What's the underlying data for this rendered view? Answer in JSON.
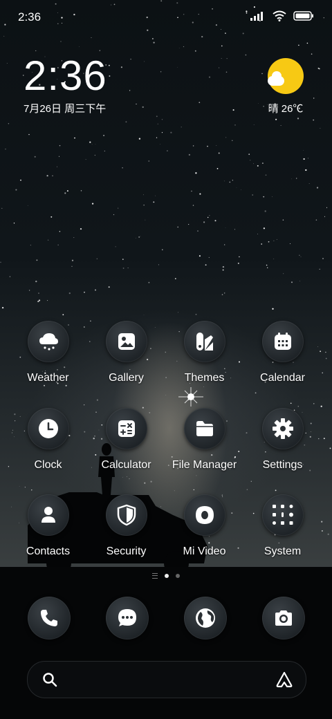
{
  "status_bar": {
    "time": "2:36",
    "icons": [
      "signal-icon",
      "wifi-icon",
      "battery-icon"
    ]
  },
  "clock_widget": {
    "time": "2:36",
    "date": "7月26日 周三下午"
  },
  "weather_widget": {
    "icon": "sun-cloud-icon",
    "text": "晴 26℃"
  },
  "apps": [
    {
      "label": "Weather",
      "icon": "weather-icon"
    },
    {
      "label": "Gallery",
      "icon": "gallery-icon"
    },
    {
      "label": "Themes",
      "icon": "themes-icon"
    },
    {
      "label": "Calendar",
      "icon": "calendar-icon"
    },
    {
      "label": "Clock",
      "icon": "clock-icon"
    },
    {
      "label": "Calculator",
      "icon": "calculator-icon"
    },
    {
      "label": "File Manager",
      "icon": "folder-icon"
    },
    {
      "label": "Settings",
      "icon": "gear-icon"
    },
    {
      "label": "Contacts",
      "icon": "person-icon"
    },
    {
      "label": "Security",
      "icon": "shield-icon"
    },
    {
      "label": "Mi Video",
      "icon": "video-icon"
    },
    {
      "label": "System",
      "icon": "folder-grid-icon"
    }
  ],
  "page_indicator": {
    "pages": 2,
    "active": 1
  },
  "dock": [
    {
      "icon": "phone-icon"
    },
    {
      "icon": "message-icon"
    },
    {
      "icon": "browser-icon"
    },
    {
      "icon": "camera-icon"
    }
  ],
  "search_bar": {
    "icons": [
      "search-icon",
      "assistant-icon"
    ]
  },
  "colors": {
    "sun": "#f7c914",
    "icon_bg": "#2a2f33",
    "background": "#06080a"
  }
}
